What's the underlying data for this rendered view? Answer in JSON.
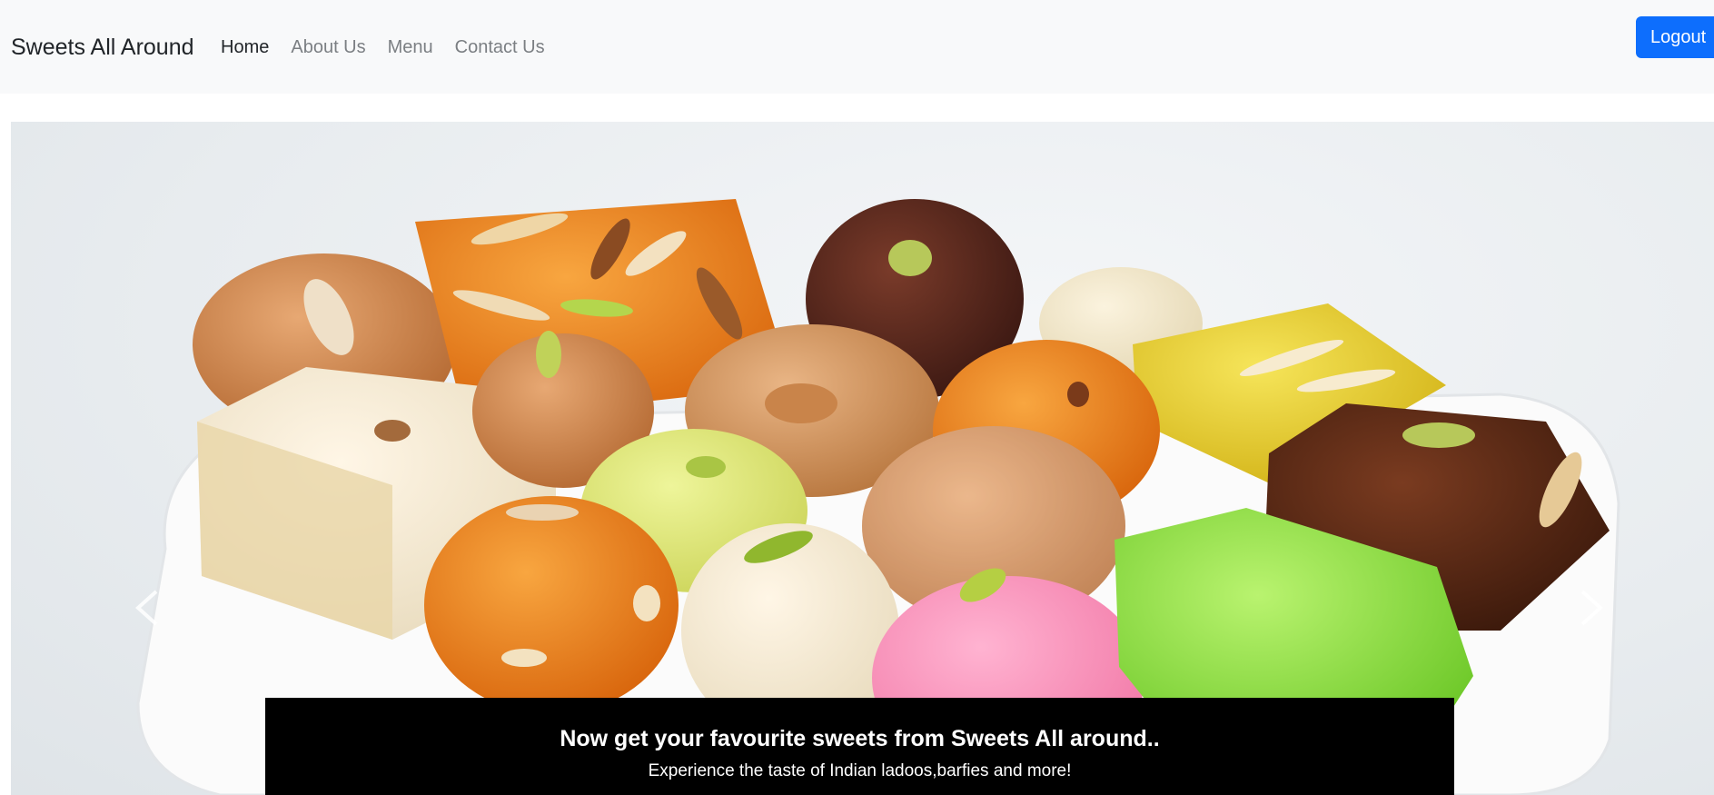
{
  "navbar": {
    "brand": "Sweets All Around",
    "links": [
      {
        "label": "Home",
        "active": true
      },
      {
        "label": "About Us",
        "active": false
      },
      {
        "label": "Menu",
        "active": false
      },
      {
        "label": "Contact Us",
        "active": false
      }
    ],
    "logout_label": "Logout"
  },
  "carousel": {
    "image_icon": "sweets-platter-image",
    "prev_icon": "chevron-left-icon",
    "next_icon": "chevron-right-icon",
    "caption": {
      "title": "Now get your favourite sweets from Sweets All around..",
      "subtitle": "Experience the taste of Indian ladoos,barfies and more!"
    }
  },
  "colors": {
    "navbar_bg": "#f8f9fa",
    "accent": "#0d6efd",
    "caption_bg": "#000000"
  }
}
